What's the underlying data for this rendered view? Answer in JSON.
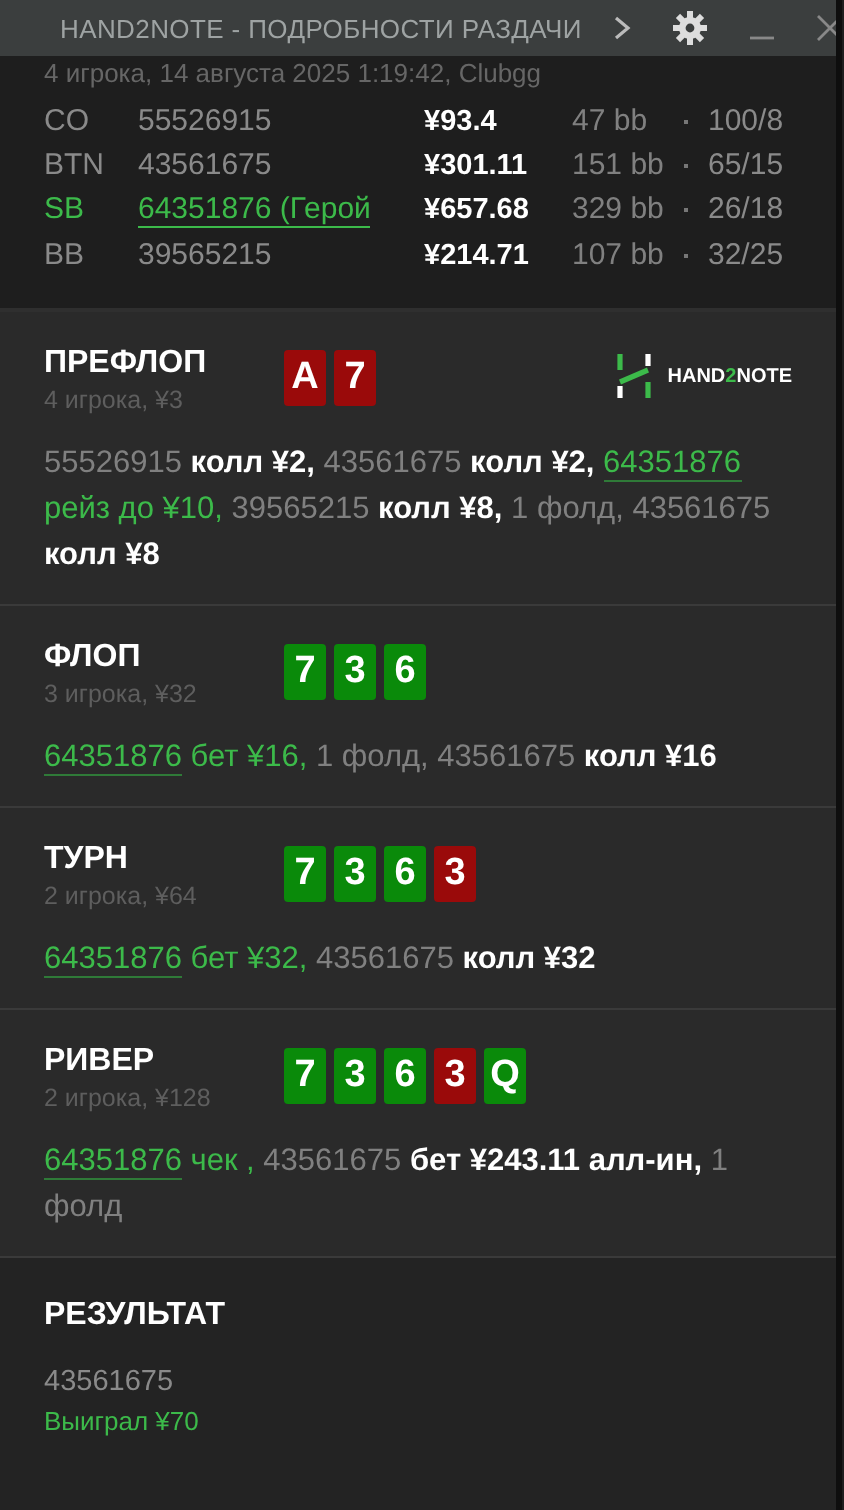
{
  "window": {
    "title": "HAND2NOTE - ПОДРОБНОСТИ РАЗДАЧИ"
  },
  "hand_info": "4 игрока, 14 августа 2025 1:19:42, Clubgg",
  "players": [
    {
      "position": "CO",
      "name": "55526915",
      "stack": "¥93.4",
      "bb": "47 bb",
      "stat": "100/8",
      "hero": false
    },
    {
      "position": "BTN",
      "name": "43561675",
      "stack": "¥301.11",
      "bb": "151 bb",
      "stat": "65/15",
      "hero": false
    },
    {
      "position": "SB",
      "name": "64351876 (Герой",
      "stack": "¥657.68",
      "bb": "329 bb",
      "stat": "26/18",
      "hero": true
    },
    {
      "position": "BB",
      "name": "39565215",
      "stack": "¥214.71",
      "bb": "107 bb",
      "stat": "32/25",
      "hero": false
    }
  ],
  "logo": {
    "parts": [
      "HAND",
      "2",
      "NOTE"
    ]
  },
  "streets": [
    {
      "title": "ПРЕФЛОП",
      "info": "4 игрока, ¥3",
      "cards": [
        {
          "rank": "A",
          "color": "#9a0a0a"
        },
        {
          "rank": "7",
          "color": "#9a0a0a"
        }
      ],
      "logo": true,
      "actions": [
        {
          "kind": "player",
          "text": "55526915"
        },
        {
          "kind": "action",
          "text": " колл ¥2,"
        },
        {
          "kind": "player",
          "text": " 43561675"
        },
        {
          "kind": "action",
          "text": " колл ¥2, "
        },
        {
          "kind": "hero",
          "text": "64351876"
        },
        {
          "kind": "hero-action",
          "text": " рейз до ¥10,"
        },
        {
          "kind": "player",
          "text": " 39565215"
        },
        {
          "kind": "action",
          "text": " колл ¥8,"
        },
        {
          "kind": "player",
          "text": " 1 фолд, 43561675"
        },
        {
          "kind": "action",
          "text": " колл ¥8"
        }
      ]
    },
    {
      "title": "ФЛОП",
      "info": "3 игрока, ¥32",
      "cards": [
        {
          "rank": "7",
          "color": "#0a8a0a"
        },
        {
          "rank": "3",
          "color": "#0a8a0a"
        },
        {
          "rank": "6",
          "color": "#0a8a0a"
        }
      ],
      "logo": false,
      "actions": [
        {
          "kind": "hero",
          "text": "64351876"
        },
        {
          "kind": "hero-action",
          "text": " бет ¥16,"
        },
        {
          "kind": "player",
          "text": " 1 фолд, 43561675"
        },
        {
          "kind": "action",
          "text": " колл ¥16"
        }
      ]
    },
    {
      "title": "ТУРН",
      "info": "2 игрока, ¥64",
      "cards": [
        {
          "rank": "7",
          "color": "#0a8a0a"
        },
        {
          "rank": "3",
          "color": "#0a8a0a"
        },
        {
          "rank": "6",
          "color": "#0a8a0a"
        },
        {
          "rank": "3",
          "color": "#9a0a0a"
        }
      ],
      "logo": false,
      "actions": [
        {
          "kind": "hero",
          "text": "64351876"
        },
        {
          "kind": "hero-action",
          "text": " бет ¥32,"
        },
        {
          "kind": "player",
          "text": " 43561675"
        },
        {
          "kind": "action",
          "text": " колл ¥32"
        }
      ]
    },
    {
      "title": "РИВЕР",
      "info": "2 игрока, ¥128",
      "cards": [
        {
          "rank": "7",
          "color": "#0a8a0a"
        },
        {
          "rank": "3",
          "color": "#0a8a0a"
        },
        {
          "rank": "6",
          "color": "#0a8a0a"
        },
        {
          "rank": "3",
          "color": "#9a0a0a"
        },
        {
          "rank": "Q",
          "color": "#0a8a0a"
        }
      ],
      "logo": false,
      "actions": [
        {
          "kind": "hero",
          "text": "64351876"
        },
        {
          "kind": "hero-action",
          "text": " чек ,"
        },
        {
          "kind": "player",
          "text": " 43561675"
        },
        {
          "kind": "action",
          "text": " бет ¥243.11 алл-ин,"
        },
        {
          "kind": "player",
          "text": " 1 фолд"
        }
      ]
    }
  ],
  "result": {
    "title": "РЕЗУЛЬТАТ",
    "winner": "43561675",
    "amount": "Выиграл ¥70"
  }
}
